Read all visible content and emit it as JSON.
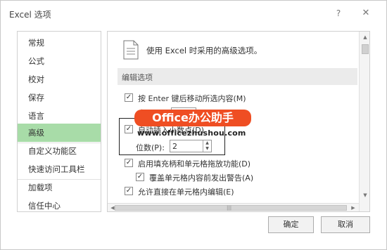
{
  "window": {
    "title": "Excel 选项",
    "help_glyph": "?",
    "close_glyph": "✕"
  },
  "sidebar": {
    "items": [
      {
        "label": "常规"
      },
      {
        "label": "公式"
      },
      {
        "label": "校对"
      },
      {
        "label": "保存"
      },
      {
        "label": "语言"
      },
      {
        "label": "高级",
        "active": true
      },
      {
        "label": "自定义功能区"
      },
      {
        "label": "快速访问工具栏"
      },
      {
        "label": "加载项"
      },
      {
        "label": "信任中心"
      }
    ]
  },
  "content": {
    "header": "使用 Excel 时采用的高级选项。",
    "section_title": "编辑选项",
    "options": [
      {
        "label": "按 Enter 键后移动所选内容(M)",
        "checked": true
      },
      {
        "label": "方",
        "checked": false
      },
      {
        "label": "自动插入小数点(D)",
        "checked": true
      },
      {
        "label": "位数(P):",
        "checked": false
      },
      {
        "label": "启用填充柄和单元格拖放功能(D)",
        "checked": true
      },
      {
        "label": "覆盖单元格内容前发出警告(A)",
        "checked": true
      },
      {
        "label": "允许直接在单元格内编辑(E)",
        "checked": true
      }
    ],
    "decimal_places_value": "2"
  },
  "watermark": {
    "brand": "Office办公助手",
    "url": "www.officezhushou.com",
    "color": "#ef4e23"
  },
  "buttons": {
    "ok": "确定",
    "cancel": "取消"
  }
}
